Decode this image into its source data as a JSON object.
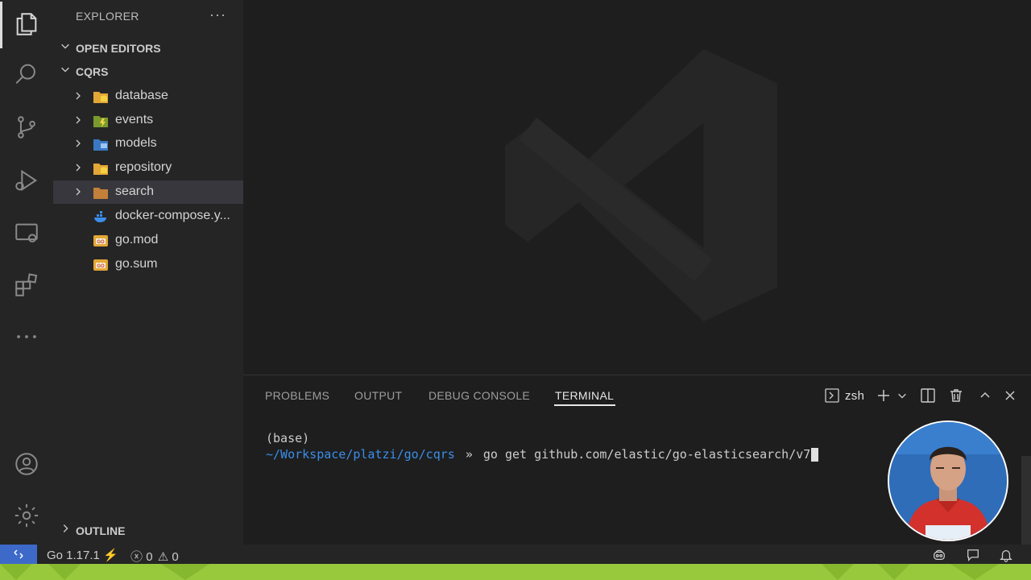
{
  "sidebar": {
    "title": "EXPLORER",
    "more_label": "···",
    "open_editors_label": "OPEN EDITORS",
    "project_label": "CQRS",
    "outline_label": "OUTLINE",
    "items": [
      {
        "name": "database",
        "kind": "folder",
        "icon": "database-folder-icon"
      },
      {
        "name": "events",
        "kind": "folder",
        "icon": "events-folder-icon"
      },
      {
        "name": "models",
        "kind": "folder",
        "icon": "models-folder-icon"
      },
      {
        "name": "repository",
        "kind": "folder",
        "icon": "repository-folder-icon"
      },
      {
        "name": "search",
        "kind": "folder",
        "icon": "folder-icon",
        "selected": true
      },
      {
        "name": "docker-compose.y...",
        "kind": "file",
        "icon": "docker-icon"
      },
      {
        "name": "go.mod",
        "kind": "file",
        "icon": "go-file-icon"
      },
      {
        "name": "go.sum",
        "kind": "file",
        "icon": "go-file-icon"
      }
    ]
  },
  "panel": {
    "tabs": [
      "PROBLEMS",
      "OUTPUT",
      "DEBUG CONSOLE",
      "TERMINAL"
    ],
    "active_tab": "TERMINAL",
    "shell_label": "zsh",
    "terminal": {
      "line1": "(base)",
      "path": "~/Workspace/platzi/go/cqrs",
      "prompt_symbol": "»",
      "command": "go get github.com/elastic/go-elasticsearch/v7"
    }
  },
  "statusbar": {
    "go_version": "Go 1.17.1",
    "errors": "0",
    "warnings": "0"
  },
  "colors": {
    "accent_blue": "#3d6ac9",
    "terminal_path": "#3b8eea",
    "bottom_strip": "#98c93c"
  }
}
